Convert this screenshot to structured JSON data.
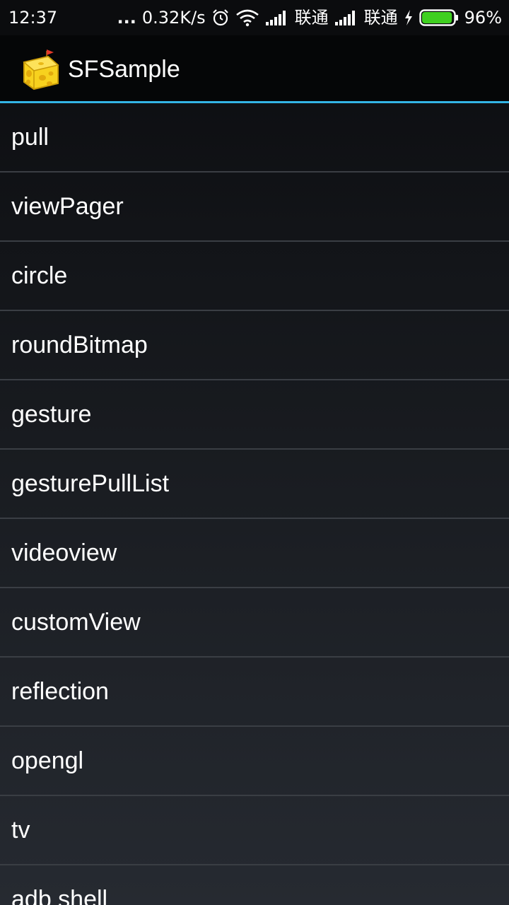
{
  "status_bar": {
    "time": "12:37",
    "dots": "...",
    "net_speed": "0.32K/s",
    "carrier1": "联通",
    "carrier2": "联通",
    "battery": "96%",
    "battery_level": 0.96,
    "icons": [
      "alarm-icon",
      "wifi-icon",
      "signal-icon",
      "signal-icon",
      "charging-icon",
      "battery-icon"
    ]
  },
  "action_bar": {
    "title": "SFSample",
    "icon": "cheese-icon"
  },
  "colors": {
    "accent": "#33b5e5",
    "battery_green": "#3fd020"
  },
  "list": {
    "items": [
      "pull",
      "viewPager",
      "circle",
      "roundBitmap",
      "gesture",
      "gesturePullList",
      "videoview",
      "customView",
      "reflection",
      "opengl",
      "tv",
      "adb shell"
    ]
  }
}
